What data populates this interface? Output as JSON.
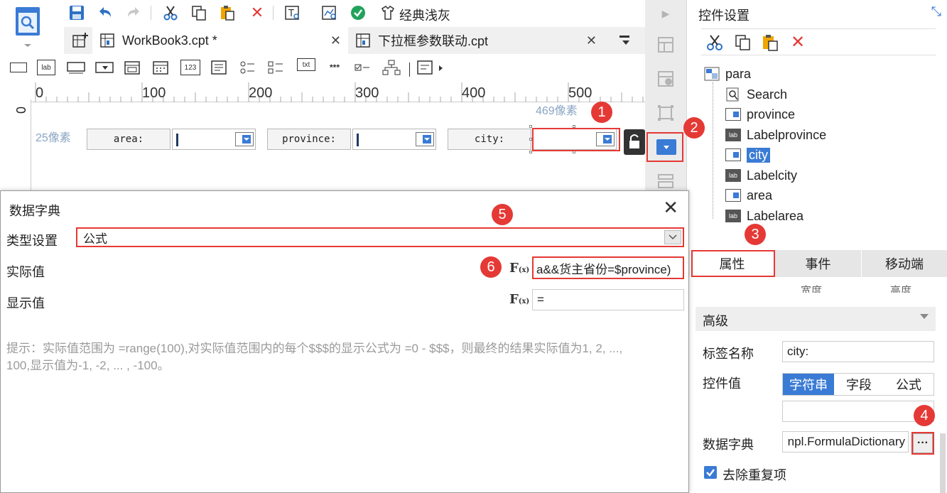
{
  "toolbar": {
    "theme_label": "经典浅灰"
  },
  "tabs": [
    {
      "label": "WorkBook3.cpt *"
    },
    {
      "label": "下拉框参数联动.cpt"
    }
  ],
  "widget_bar": {
    "lab": "lab",
    "num": "123",
    "txt": "txt",
    "pwd": "***"
  },
  "ruler": {
    "ticks": [
      "0",
      "100",
      "200",
      "300",
      "400",
      "500"
    ],
    "vertical_zero": "0"
  },
  "canvas": {
    "width_hint": "469像素",
    "height_hint": "25像素",
    "fields": [
      {
        "label": "area:"
      },
      {
        "label": "province:"
      },
      {
        "label": "city:"
      }
    ]
  },
  "right_panel": {
    "title": "控件设置",
    "tree": {
      "root": "para",
      "items": [
        {
          "label": "Search",
          "icon": "search-doc-icon"
        },
        {
          "label": "province",
          "icon": "combobox-icon"
        },
        {
          "label": "Labelprovince",
          "icon": "label-icon"
        },
        {
          "label": "city",
          "icon": "combobox-icon",
          "selected": true
        },
        {
          "label": "Labelcity",
          "icon": "label-icon"
        },
        {
          "label": "area",
          "icon": "combobox-icon"
        },
        {
          "label": "Labelarea",
          "icon": "label-icon"
        }
      ]
    },
    "prop_tabs": [
      "属性",
      "事件",
      "移动端"
    ],
    "partial_row": [
      "宽度",
      "高度"
    ],
    "section_advanced": "高级",
    "label_name_label": "标签名称",
    "label_name_value": "city:",
    "widget_value_label": "控件值",
    "value_type_options": [
      "字符串",
      "字段",
      "公式"
    ],
    "value_type_selected": "字符串",
    "data_dict_label": "数据字典",
    "data_dict_value": "npl.FormulaDictionary",
    "more_button": "···",
    "dedupe_label": "去除重复项",
    "dedupe_checked": true
  },
  "dialog": {
    "title": "数据字典",
    "type_label": "类型设置",
    "type_value": "公式",
    "actual_label": "实际值",
    "actual_value": "a&&货主省份=$province)",
    "display_label": "显示值",
    "display_value": "=",
    "hint_line1": "提示：实际值范围为 =range(100),对实际值范围内的每个$$$的显示公式为 =0 - $$$，则最终的结果实际值为1, 2, ...,",
    "hint_line2": "100,显示值为-1, -2, ... , -100。"
  },
  "callouts": [
    "1",
    "2",
    "3",
    "4",
    "5",
    "6"
  ],
  "colors": {
    "accent": "#3a7bd5",
    "callout": "#e53935",
    "selection": "#3a7bd5"
  }
}
